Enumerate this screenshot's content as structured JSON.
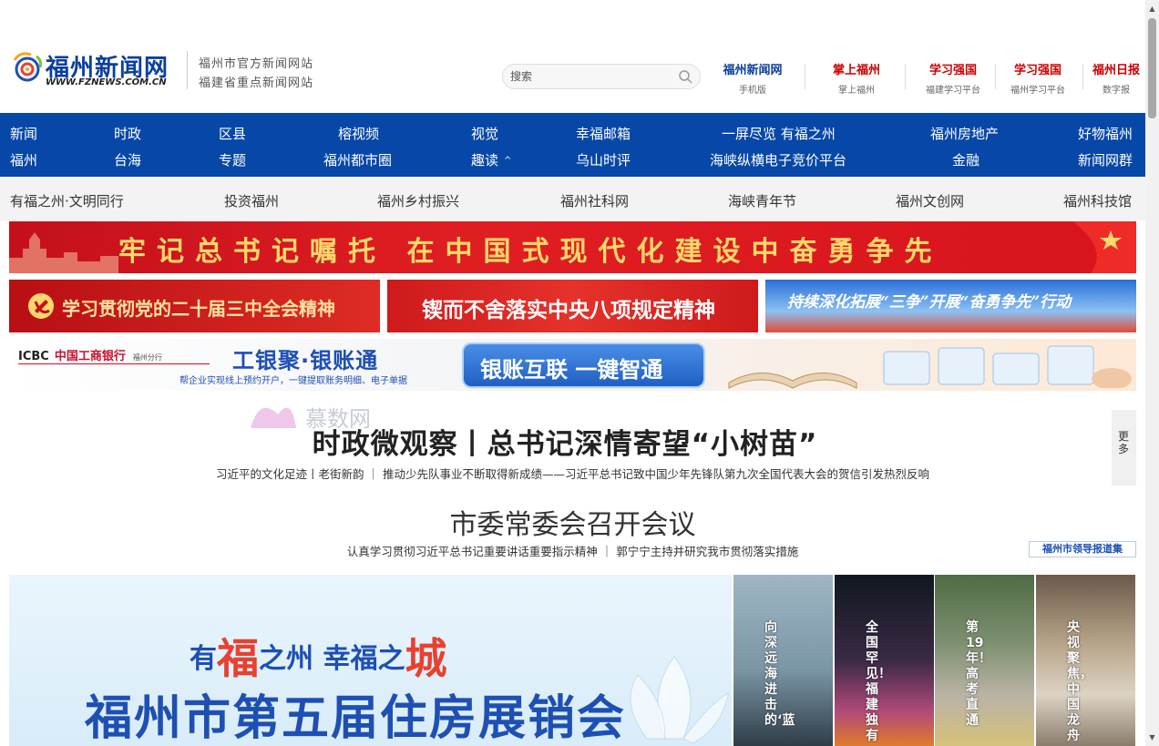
{
  "header": {
    "logo_title": "福州新闻网",
    "logo_url": "WWW.FZNEWS.COM.CN",
    "slogan_1": "福州市官方新闻网站",
    "slogan_2": "福建省重点新闻网站",
    "search_placeholder": "搜索",
    "apps": [
      {
        "brand": "福州新闻网",
        "caption": "手机版"
      },
      {
        "brand": "掌上福州",
        "caption": "掌上福州"
      },
      {
        "brand": "学习强国",
        "caption": "福建学习平台"
      },
      {
        "brand": "学习强国",
        "caption": "福州学习平台"
      },
      {
        "brand": "福州日报",
        "caption": "数字报"
      }
    ]
  },
  "nav": {
    "row1": [
      "新闻",
      "时政",
      "区县",
      "榕视频",
      "视觉",
      "幸福邮箱",
      "一屏尽览 有福之州",
      "福州房地产",
      "好物福州"
    ],
    "row2": [
      "福州",
      "台海",
      "专题",
      "福州都市圈",
      "趣读",
      "乌山时评",
      "海峡纵横电子竞价平台",
      "金融",
      "新闻网群"
    ],
    "more_chevron": "^"
  },
  "subnav": [
    "有福之州·文明同行",
    "投资福州",
    "福州乡村振兴",
    "福州社科网",
    "海峡青年节",
    "福州文创网",
    "福州科技馆"
  ],
  "banners": {
    "main": "牢记总书记嘱托 在中国式现代化建设中奋勇争先",
    "b1": "学习贯彻党的二十届三中全会精神",
    "b2": "锲而不舍落实中央八项规定精神",
    "b3": "持续深化拓展“三争”开展“奋勇争先”行动",
    "icbc": {
      "logo": "ICBC",
      "bank_name": "中国工商银行",
      "branch": "福州分行",
      "title": "工银聚·银账通",
      "desc": "帮企业实现线上预约开户，一键提取账务明细、电子单据",
      "button": "银账互联 一键智通"
    }
  },
  "watermark": "慕数网",
  "headline1": {
    "title": "时政微观察丨总书记深情寄望“小树苗”",
    "sub": "习近平的文化足迹丨老街新韵 ｜ 推动少先队事业不断取得新成绩——习近平总书记致中国少年先锋队第九次全国代表大会的贺信引发热烈反响"
  },
  "more_label": "更多",
  "headline2": {
    "title": "市委常委会召开会议",
    "sub": "认真学习贯彻习近平总书记重要讲话重要指示精神 ｜ 郭宁宁主持并研究我市贯彻落实措施"
  },
  "leader_link": "福州市领导报道集",
  "promo": {
    "line1_a": "有",
    "line1_b": "福",
    "line1_c": "之州  幸福之",
    "line1_d": "城",
    "line2": "福州市第五届住房展销会"
  },
  "thumbs": [
    "向深远海进击的‘蓝",
    "全国罕见！福建独有",
    "第19年！高考直通",
    "央视聚焦，中国龙舟"
  ],
  "colors": {
    "nav_blue": "#0647a8",
    "banner_red": "#d7141c",
    "accent_blue": "#1e4fb3"
  }
}
